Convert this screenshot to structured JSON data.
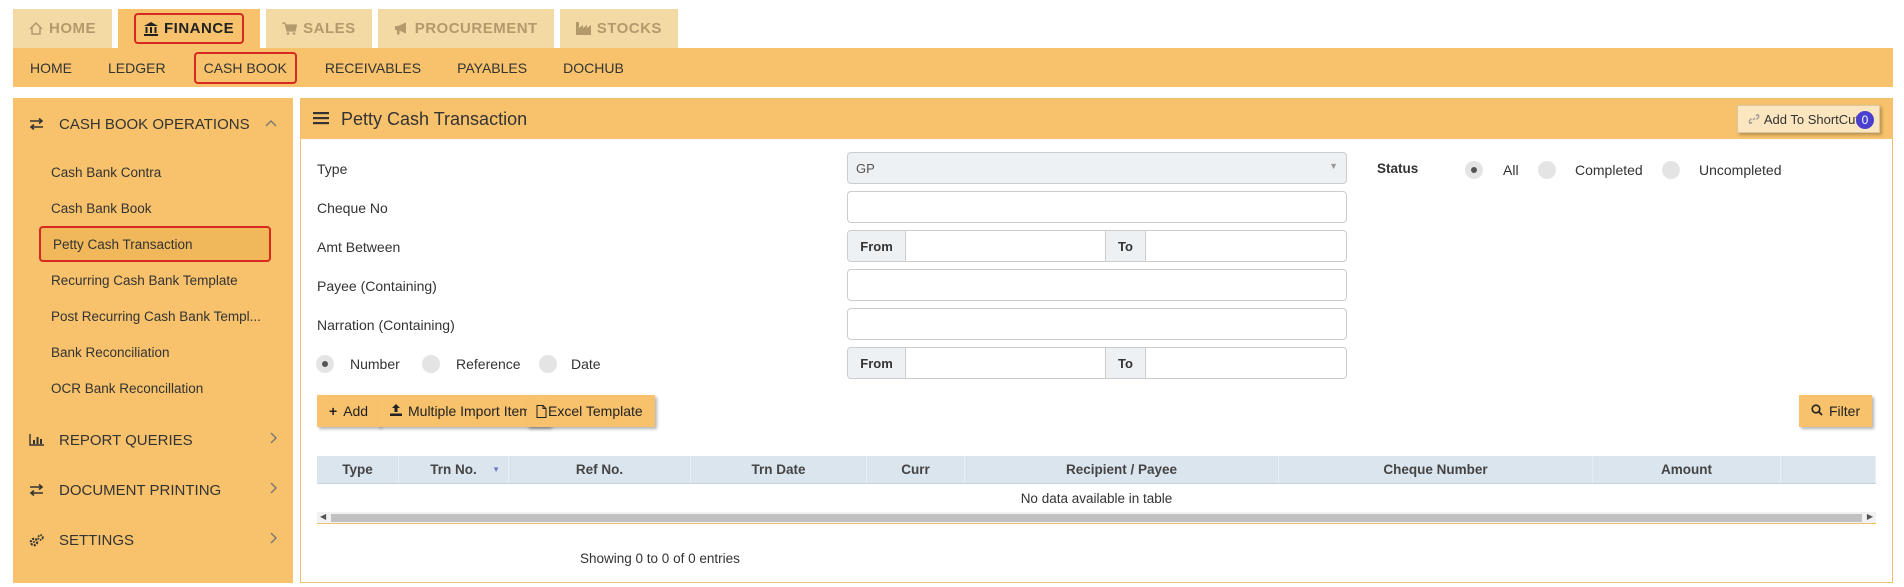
{
  "top_tabs": [
    {
      "label": "HOME",
      "icon": "home-icon"
    },
    {
      "label": "FINANCE",
      "icon": "bank-icon"
    },
    {
      "label": "SALES",
      "icon": "cart-icon"
    },
    {
      "label": "PROCUREMENT",
      "icon": "megaphone-icon"
    },
    {
      "label": "STOCKS",
      "icon": "factory-icon"
    }
  ],
  "subnav": [
    "HOME",
    "LEDGER",
    "CASH BOOK",
    "RECEIVABLES",
    "PAYABLES",
    "DOCHUB"
  ],
  "sidebar": {
    "sections": [
      {
        "label": "CASH BOOK OPERATIONS",
        "icon": "exchange-icon"
      },
      {
        "label": "REPORT QUERIES",
        "icon": "bar-chart-icon"
      },
      {
        "label": "DOCUMENT PRINTING",
        "icon": "exchange-icon"
      },
      {
        "label": "SETTINGS",
        "icon": "gears-icon"
      }
    ],
    "items": [
      "Cash Bank Contra",
      "Cash Bank Book",
      "Petty Cash Transaction",
      "Recurring Cash Bank Template",
      "Post Recurring Cash Bank Templ...",
      "Bank Reconciliation",
      "OCR Bank Reconcillation"
    ]
  },
  "panel": {
    "title": "Petty Cash Transaction",
    "shortcut_label": "Add To ShortCut",
    "shortcut_count": "0"
  },
  "form": {
    "type_label": "Type",
    "type_value": "GP",
    "cheque_label": "Cheque No",
    "amt_label": "Amt Between",
    "payee_label": "Payee (Containing)",
    "narration_label": "Narration (Containing)",
    "from_label": "From",
    "to_label": "To",
    "sort_options": [
      "Number",
      "Reference",
      "Date"
    ],
    "status_label": "Status",
    "status_options": [
      "All",
      "Completed",
      "Uncompleted"
    ]
  },
  "buttons": {
    "add": "Add",
    "import": "Multiple Import Items",
    "template": "Excel Template",
    "filter": "Filter"
  },
  "table": {
    "columns": [
      "Type",
      "Trn No.",
      "Ref No.",
      "Trn Date",
      "Curr",
      "Recipient / Payee",
      "Cheque Number",
      "Amount"
    ],
    "empty_text": "No data available in table",
    "info": "Showing 0 to 0 of 0 entries"
  }
}
